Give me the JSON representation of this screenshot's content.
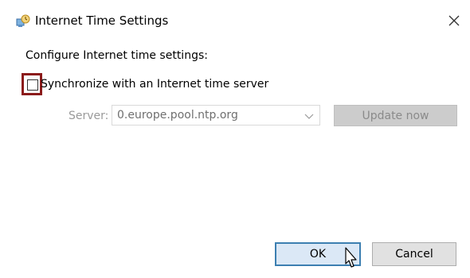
{
  "window": {
    "title": "Internet Time Settings",
    "title_icon": "clock-network-icon",
    "close_glyph": "×"
  },
  "content": {
    "heading": "Configure Internet time settings:",
    "sync_checkbox": {
      "label": "Synchronize with an Internet time server",
      "checked": false
    },
    "server": {
      "label": "Server:",
      "value": "0.europe.pool.ntp.org"
    },
    "update_button": "Update now"
  },
  "buttons": {
    "ok": "OK",
    "cancel": "Cancel"
  },
  "colors": {
    "highlight": "#8b1a1a",
    "ok_border": "#3c7fb1",
    "ok_fill": "#dbe8f6",
    "disabled_text": "#9a9a9a"
  }
}
